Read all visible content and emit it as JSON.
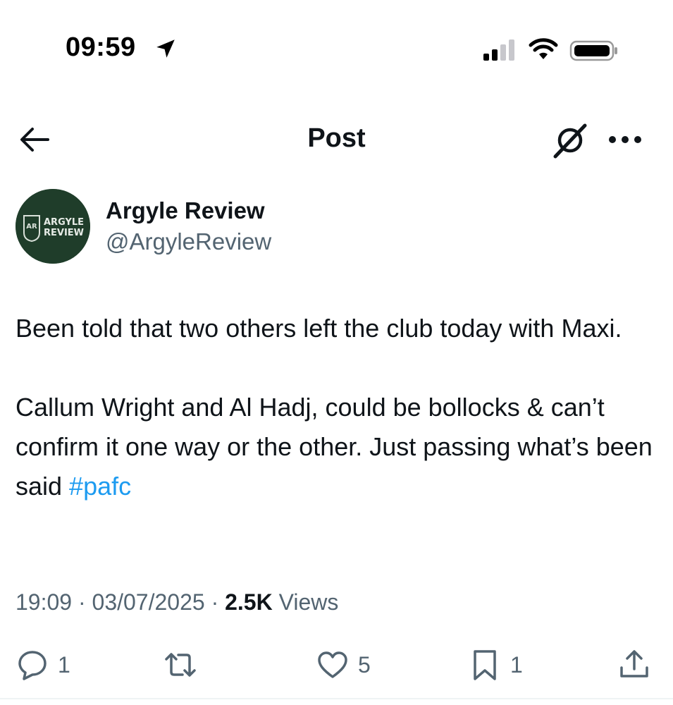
{
  "status_bar": {
    "time": "09:59"
  },
  "header": {
    "title": "Post"
  },
  "author": {
    "name": "Argyle Review",
    "handle": "@ArgyleReview",
    "avatar_text_line1": "ARGYLE",
    "avatar_text_line2": "REVIEW",
    "avatar_monogram": "AR"
  },
  "tweet": {
    "line1": "Been told that two others left the club today with Maxi.",
    "line2_text": "Callum Wright and Al Hadj, could be bollocks & can’t confirm it one way or the other. Just passing what’s been said ",
    "hashtag": "#pafc"
  },
  "meta": {
    "time": "19:09",
    "separator": " · ",
    "date": "03/07/2025",
    "views_count": "2.5K",
    "views_label": " Views"
  },
  "actions": {
    "replies": "1",
    "reposts": "",
    "likes": "5",
    "bookmarks": "1"
  },
  "icons": {
    "location": "location-arrow-icon",
    "signal": "cellular-signal-icon",
    "wifi": "wifi-icon",
    "battery": "battery-icon",
    "back": "back-arrow-icon",
    "grok": "grok-icon",
    "more": "more-options-icon",
    "reply": "reply-icon",
    "repost": "repost-icon",
    "like": "heart-icon",
    "bookmark": "bookmark-icon",
    "share": "share-icon"
  },
  "colors": {
    "text_primary": "#0f1419",
    "text_secondary": "#536471",
    "link": "#1d9bf0",
    "avatar_bg": "#1f3d2a"
  }
}
